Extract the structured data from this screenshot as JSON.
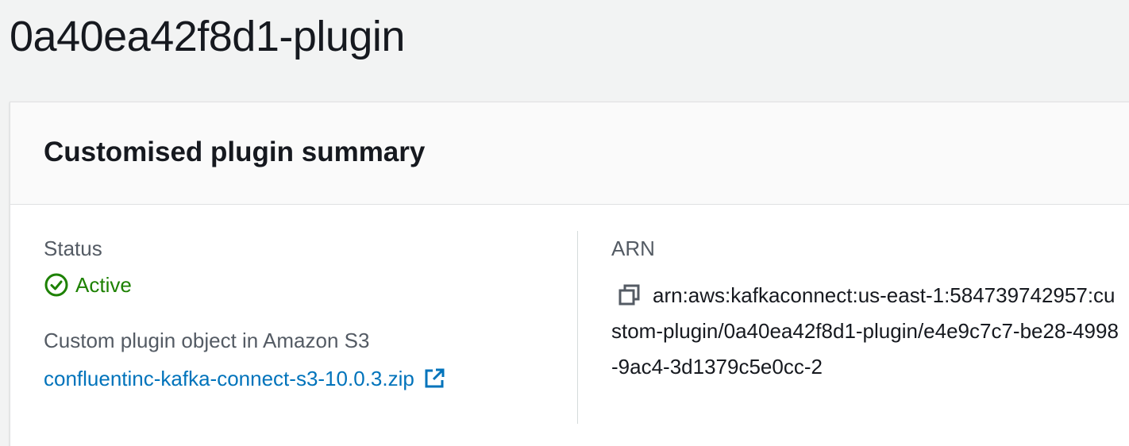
{
  "page": {
    "title": "0a40ea42f8d1-plugin"
  },
  "summary": {
    "title": "Customised plugin summary",
    "status": {
      "label": "Status",
      "value": "Active",
      "color": "#1d8102",
      "icon": "check-circle-icon"
    },
    "s3_object": {
      "label": "Custom plugin object in Amazon S3",
      "link_text": "confluentinc-kafka-connect-s3-10.0.3.zip",
      "link_color": "#0073bb",
      "icon": "external-link-icon"
    },
    "arn": {
      "label": "ARN",
      "value": "arn:aws:kafkaconnect:us-east-1:584739742957:custom-plugin/0a40ea42f8d1-plugin/e4e9c7c7-be28-4998-9ac4-3d1379c5e0cc-2",
      "icon": "copy-icon"
    }
  }
}
